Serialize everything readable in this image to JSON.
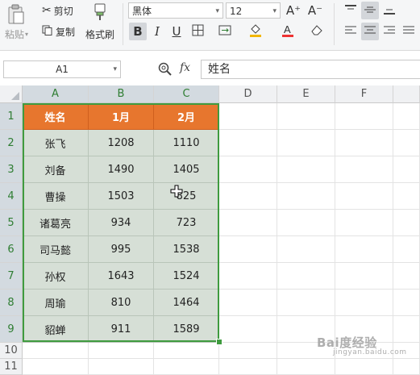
{
  "ribbon": {
    "paste_label": "粘贴",
    "cut_label": "剪切",
    "copy_label": "复制",
    "format_painter_label": "格式刷",
    "font_name": "黑体",
    "font_size": "12",
    "grow_font_glyph": "A⁺",
    "shrink_font_glyph": "A⁻",
    "bold_glyph": "B",
    "italic_glyph": "I",
    "underline_glyph": "U"
  },
  "formula_bar": {
    "name_box": "A1",
    "fx_label": "fx",
    "value": "姓名"
  },
  "sheet": {
    "columns": [
      "A",
      "B",
      "C",
      "D",
      "E",
      "F"
    ],
    "rows": [
      "1",
      "2",
      "3",
      "4",
      "5",
      "6",
      "7",
      "8",
      "9",
      "10",
      "11"
    ],
    "table": [
      [
        "姓名",
        "1月",
        "2月"
      ],
      [
        "张飞",
        "1208",
        "1110"
      ],
      [
        "刘备",
        "1490",
        "1405"
      ],
      [
        "曹操",
        "1503",
        "825"
      ],
      [
        "诸葛亮",
        "934",
        "723"
      ],
      [
        "司马懿",
        "995",
        "1538"
      ],
      [
        "孙权",
        "1643",
        "1524"
      ],
      [
        "周瑜",
        "810",
        "1464"
      ],
      [
        "貂蝉",
        "911",
        "1589"
      ]
    ]
  },
  "colors": {
    "header_fill": "#e7762e",
    "data_fill": "#d6dfd6",
    "selection_border": "#3f9b3f"
  },
  "watermark": {
    "text": "Bai度经验",
    "sub": "jingyan.baidu.com"
  }
}
